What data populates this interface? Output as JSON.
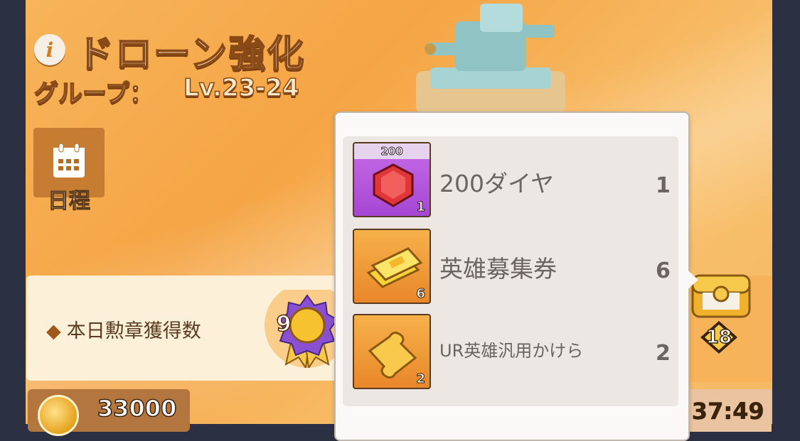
{
  "header": {
    "title": "ドローン強化",
    "group_label": "グループ：",
    "group_value": "Lv.23-24"
  },
  "schedule": {
    "label": "日程"
  },
  "medals": {
    "label": "本日勲章獲得数",
    "count": "9"
  },
  "coins": {
    "value": "33000"
  },
  "chest": {
    "count": "18"
  },
  "timer": {
    "value": ":37:49"
  },
  "rewards": [
    {
      "name": "200ダイヤ",
      "count": "1",
      "tile_cap": "200",
      "tile_qty": "1",
      "icon": "ruby-gem-icon"
    },
    {
      "name": "英雄募集券",
      "count": "6",
      "tile_qty": "6",
      "icon": "gold-ticket-icon"
    },
    {
      "name": "UR英雄汎用かけら",
      "count": "2",
      "tile_qty": "2",
      "icon": "puzzle-piece-icon"
    }
  ],
  "colors": {
    "panel": "#f5a545",
    "popup_bg": "#fbf9f7",
    "list_bg": "#ece7e2",
    "tile_purple": "#a646d4",
    "tile_orange": "#e8872a"
  }
}
